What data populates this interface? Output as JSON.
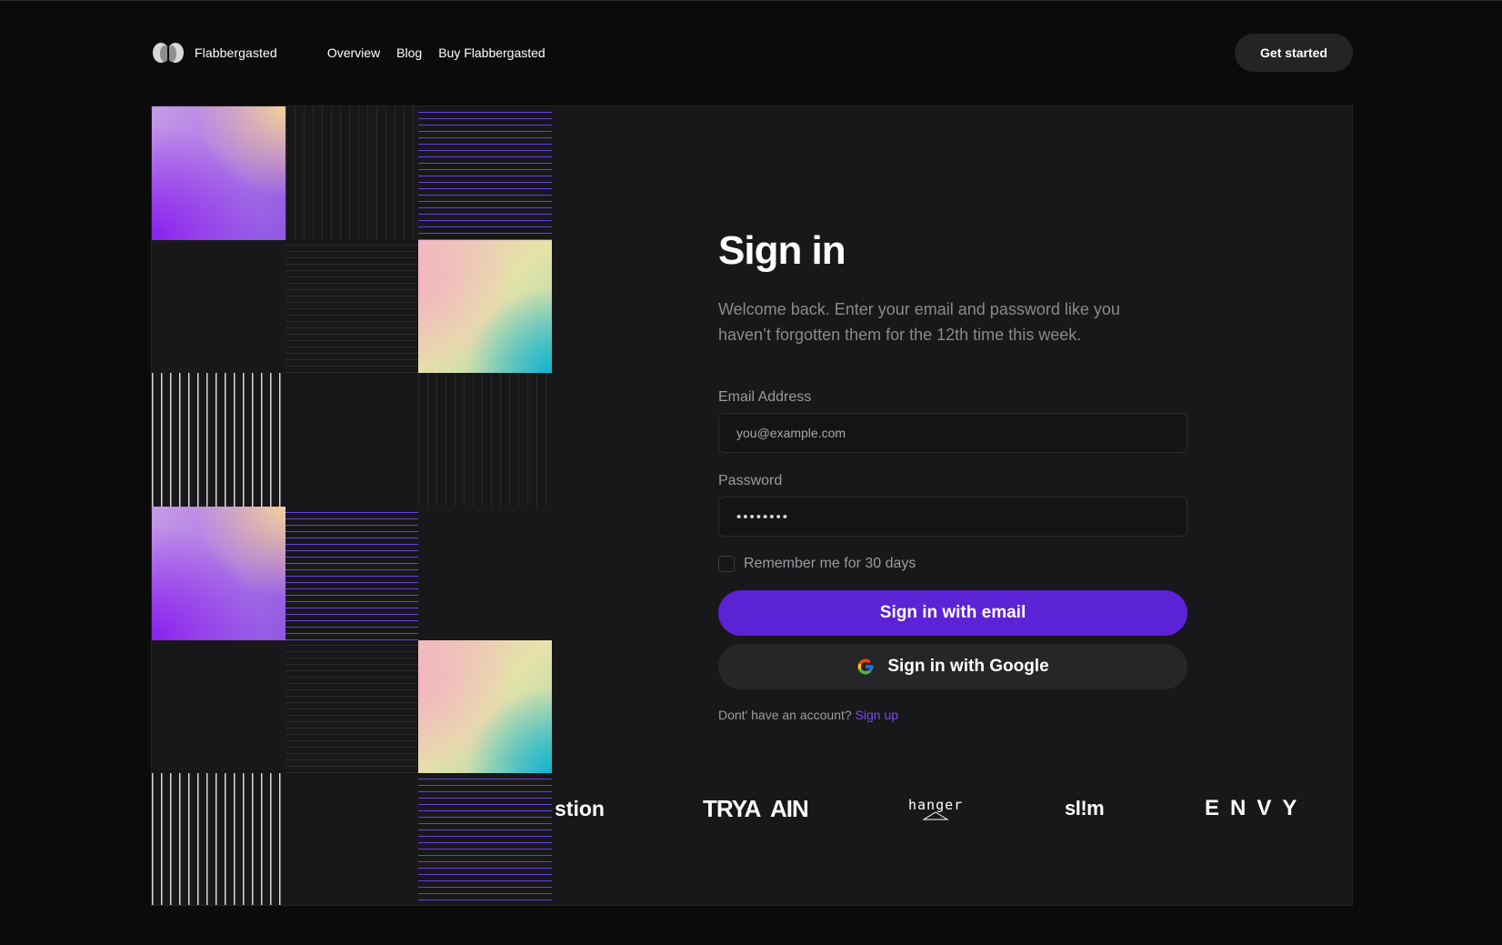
{
  "header": {
    "brand": "Flabbergasted",
    "logo_icon": "butterfly-logo-icon",
    "nav": [
      "Overview",
      "Blog",
      "Buy Flabbergasted"
    ],
    "cta": "Get started"
  },
  "signin": {
    "title": "Sign in",
    "subtitle": "Welcome back. Enter your email and password like you haven’t forgotten them for the 12th time this week.",
    "email_label": "Email Address",
    "email_placeholder": "you@example.com",
    "password_label": "Password",
    "password_value": "••••••••",
    "remember_label": "Remember me for 30 days",
    "email_button": "Sign in with email",
    "google_button": "Sign in with Google",
    "google_icon": "google-icon",
    "no_account": "Dont' have an account?",
    "signup": "Sign up"
  },
  "logos": [
    "stion",
    "TRYA  AIN",
    "hanger",
    "sl!m",
    "ENVY"
  ],
  "colors": {
    "page_bg": "#0b0b0c",
    "card_bg": "#18181a",
    "primary": "#5b22d6",
    "link": "#7a45f2",
    "secondary_button": "#262628"
  }
}
